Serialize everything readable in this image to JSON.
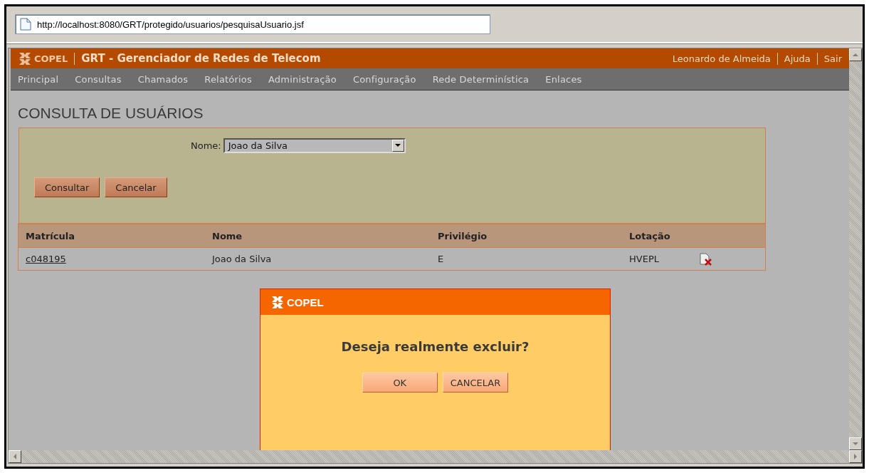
{
  "browser": {
    "url": "http://localhost:8080/GRT/protegido/usuarios/pesquisaUsuario.jsf"
  },
  "header": {
    "brand": "COPEL",
    "title": "GRT - Gerenciador de Redes de Telecom",
    "user": "Leonardo de Almeida",
    "links": [
      "Ajuda",
      "Sair"
    ]
  },
  "menu": [
    "Principal",
    "Consultas",
    "Chamados",
    "Relatórios",
    "Administração",
    "Configuração",
    "Rede Determinística",
    "Enlaces"
  ],
  "page_title": "CONSULTA DE USUÁRIOS",
  "form": {
    "field_label": "Nome:",
    "field_value": "Joao da Silva",
    "buttons": [
      "Consultar",
      "Cancelar"
    ]
  },
  "table": {
    "columns": [
      "Matrícula",
      "Nome",
      "Privilégio",
      "Lotação"
    ],
    "rows": [
      {
        "cells": [
          "c048195",
          "Joao da Silva",
          "E",
          "HVEPL"
        ]
      }
    ]
  },
  "dialog": {
    "brand": "COPEL",
    "message": "Deseja realmente excluir?",
    "buttons": [
      "OK",
      "CANCELAR"
    ]
  }
}
